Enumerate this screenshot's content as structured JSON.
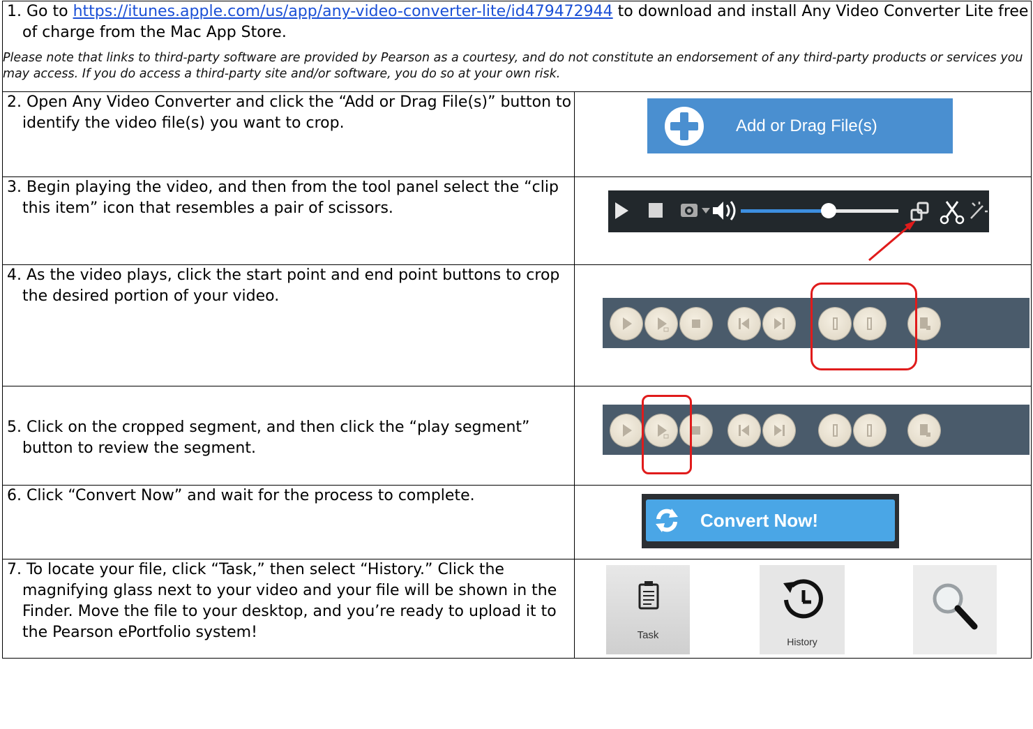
{
  "step1": {
    "prefix": "1. Go to ",
    "link": "https://itunes.apple.com/us/app/any-video-converter-lite/id479472944",
    "suffix": " to download and install Any Video Converter Lite free of charge from the Mac App Store.",
    "note": "Please note that links to third-party software are provided by Pearson as a courtesy, and do not constitute an endorsement of any third-party products or services you may access. If you do access a third-party site and/or software, you do so at your own risk."
  },
  "step2": {
    "text": "2. Open Any Video Converter and click the “Add or Drag File(s)” button to identify the video file(s) you want to crop.",
    "button_label": "Add or Drag File(s)",
    "button_color": "#4a8fd0"
  },
  "step3": {
    "text": "3. Begin playing the video, and then from the tool panel select the “clip this item” icon that resembles a pair of scissors.",
    "icons": [
      "play-icon",
      "stop-icon",
      "camera-icon",
      "volume-icon",
      "volume-slider",
      "window-icon",
      "scissors-icon",
      "magic-wand-icon"
    ],
    "volume_level": 0.55,
    "arrow_color": "#e01b1b"
  },
  "step4": {
    "text": "4. As the video plays, click the start point and end point buttons to crop the desired portion of your video.",
    "buttons": [
      "play-icon",
      "play-segment-icon",
      "stop-icon",
      "previous-icon",
      "next-icon",
      "start-point-icon",
      "end-point-icon",
      "add-segment-icon"
    ],
    "highlight_color": "#e01b1b"
  },
  "step5": {
    "text": "5. Click on the cropped segment, and then click the “play segment” button to review the segment."
  },
  "step6": {
    "text": "6. Click “Convert Now” and wait for the process to complete.",
    "button_label": "Convert Now!",
    "button_color": "#4aa6e6"
  },
  "step7": {
    "text": "7. To locate your file, click “Task,” then select “History.” Click the magnifying glass next to your video and your file will be shown in the Finder. Move the file to your desktop, and you’re ready to upload it to the Pearson ePortfolio system!",
    "task_label": "Task",
    "history_label": "History"
  }
}
